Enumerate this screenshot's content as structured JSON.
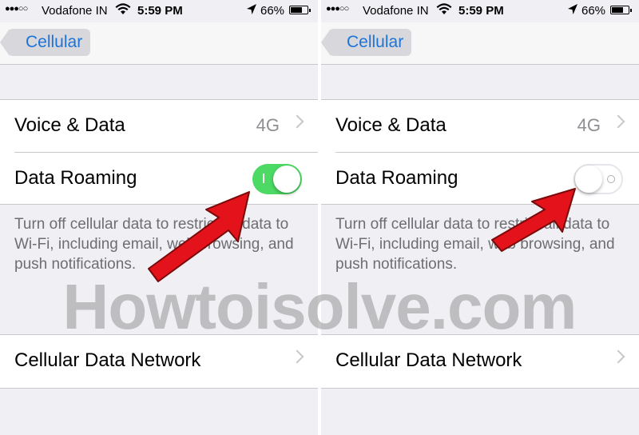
{
  "status_bar": {
    "signal": "●●●○○",
    "carrier": "Vodafone IN",
    "time": "5:59 PM",
    "battery": "66%"
  },
  "nav": {
    "back_label": "Cellular"
  },
  "rows": {
    "voice_data_label": "Voice & Data",
    "voice_data_value": "4G",
    "data_roaming_label": "Data Roaming",
    "cellular_network_label": "Cellular Data Network"
  },
  "footer_text": "Turn off cellular data to restrict all data to Wi-Fi, including email, web browsing, and push notifications.",
  "panels": [
    {
      "data_roaming_enabled": true
    },
    {
      "data_roaming_enabled": false
    }
  ],
  "colors": {
    "accent": "#1e73d6",
    "toggle_on": "#4cd964",
    "arrow": "#e3121b"
  },
  "icons": {
    "wifi": "wifi-icon",
    "location": "location-arrow-icon",
    "battery": "battery-icon",
    "chevron": "chevron-right-icon"
  },
  "watermark": "Howtoisolve.com"
}
